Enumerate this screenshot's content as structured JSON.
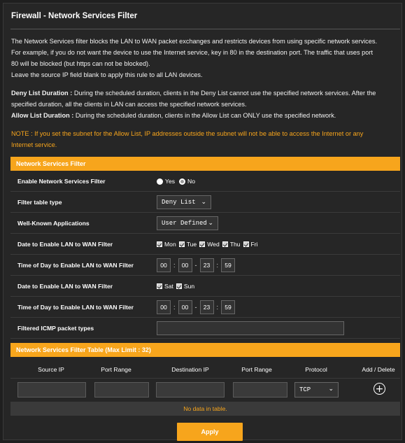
{
  "page": {
    "title": "Firewall - Network Services Filter",
    "desc_line1": "The Network Services filter blocks the LAN to WAN packet exchanges and restricts devices from using specific network services.",
    "desc_line2": "For example, if you do not want the device to use the Internet service, key in 80 in the destination port. The traffic that uses port",
    "desc_line3": "80 will be blocked (but https can not be blocked).",
    "desc_line4": "Leave the source IP field blank to apply this rule to all LAN devices.",
    "deny_label": "Deny List Duration :",
    "deny_text1": " During the scheduled duration, clients in the Deny List cannot use the specified network services. After the",
    "deny_text2": "specified duration, all the clients in LAN can access the specified network services.",
    "allow_label": "Allow List Duration :",
    "allow_text": " During the scheduled duration, clients in the Allow List can ONLY use the specified network.",
    "note1": "NOTE : If you set the subnet for the Allow List, IP addresses outside the subnet will not be able to access the Internet or any",
    "note2": "Internet service."
  },
  "filter": {
    "section_title": "Network Services Filter",
    "enable_label": "Enable Network Services Filter",
    "enable_yes": "Yes",
    "enable_no": "No",
    "table_type_label": "Filter table type",
    "table_type_value": "Deny List",
    "apps_label": "Well-Known Applications",
    "apps_value": "User Defined",
    "date_weekday_label": "Date to Enable LAN to WAN Filter",
    "weekdays": [
      "Mon",
      "Tue",
      "Wed",
      "Thu",
      "Fri"
    ],
    "time_weekday_label": "Time of Day to Enable LAN to WAN Filter",
    "time_weekday": {
      "start_h": "00",
      "start_m": "00",
      "end_h": "23",
      "end_m": "59"
    },
    "date_weekend_label": "Date to Enable LAN to WAN Filter",
    "weekend": [
      "Sat",
      "Sun"
    ],
    "time_weekend_label": "Time of Day to Enable LAN to WAN Filter",
    "time_weekend": {
      "start_h": "00",
      "start_m": "00",
      "end_h": "23",
      "end_m": "59"
    },
    "icmp_label": "Filtered ICMP packet types",
    "icmp_value": ""
  },
  "table": {
    "section_title": "Network Services Filter Table (Max Limit : 32)",
    "headers": [
      "Source IP",
      "Port Range",
      "Destination IP",
      "Port Range",
      "Protocol",
      "Add / Delete"
    ],
    "protocol_value": "TCP",
    "empty_text": "No data in table."
  },
  "apply_label": "Apply",
  "colors": {
    "accent": "#f7a51c",
    "background": "#262626"
  },
  "icons": {
    "add": "plus-circle-icon",
    "dropdown": "chevron-down-icon"
  }
}
